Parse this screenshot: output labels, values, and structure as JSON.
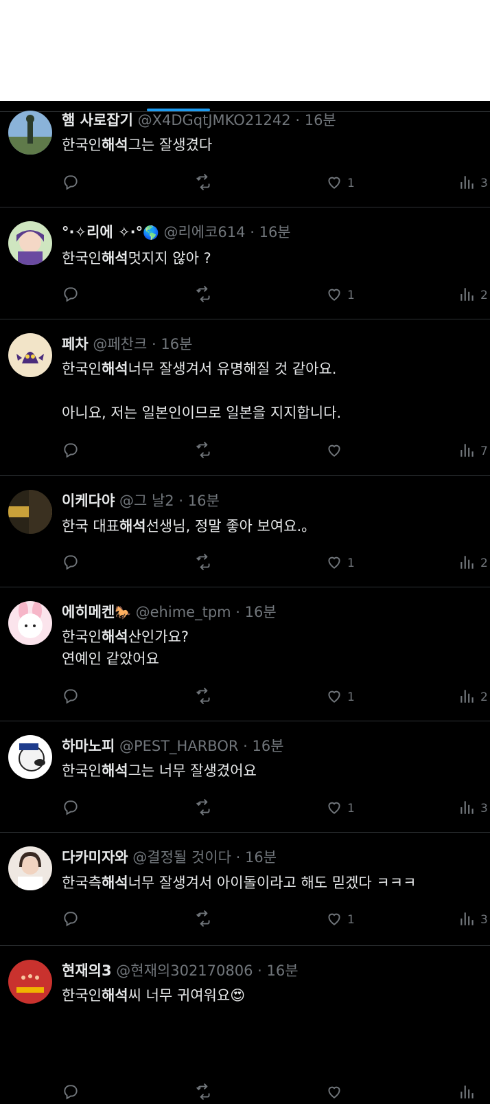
{
  "tweets": [
    {
      "name": "햄 사로잡기",
      "emoji": "",
      "handle": "@X4DGqtJMKO21242",
      "time": "16분",
      "body": [
        {
          "t": "한국인"
        },
        {
          "t": "해석",
          "b": true
        },
        {
          "t": "그는 잘생겼다"
        }
      ],
      "likes": "1",
      "views": "3"
    },
    {
      "name": "°·✧리에 ✧·°",
      "emoji": "🌎",
      "handle": "@리에코614",
      "time": "16분",
      "body": [
        {
          "t": "한국인"
        },
        {
          "t": "해석",
          "b": true
        },
        {
          "t": "멋지지 않아 ?"
        }
      ],
      "likes": "1",
      "views": "2"
    },
    {
      "name": "페차",
      "emoji": "",
      "handle": "@페찬크",
      "time": "16분",
      "body": [
        {
          "t": "한국인"
        },
        {
          "t": "해석",
          "b": true
        },
        {
          "t": "너무 잘생겨서 유명해질 것 같아요.\n\n아니요, 저는 일본인이므로 일본을 지지합니다."
        }
      ],
      "likes": "",
      "views": "7"
    },
    {
      "name": "이케다야",
      "emoji": "",
      "handle": "@그 날2",
      "time": "16분",
      "body": [
        {
          "t": "한국 대표"
        },
        {
          "t": "해석",
          "b": true
        },
        {
          "t": "선생님, 정말 좋아 보여요.。"
        }
      ],
      "likes": "1",
      "views": "2"
    },
    {
      "name": "에히메켄",
      "emoji": "🐎",
      "handle": "@ehime_tpm",
      "time": "16분",
      "body": [
        {
          "t": "한국인"
        },
        {
          "t": "해석",
          "b": true
        },
        {
          "t": "산인가요?\n연예인 같았어요"
        }
      ],
      "likes": "1",
      "views": "2"
    },
    {
      "name": "하마노피",
      "emoji": "",
      "handle": "@PEST_HARBOR",
      "time": "16분",
      "body": [
        {
          "t": "한국인"
        },
        {
          "t": "해석",
          "b": true
        },
        {
          "t": "그는 너무 잘생겼어요"
        }
      ],
      "likes": "1",
      "views": "3"
    },
    {
      "name": "다카미자와",
      "emoji": "",
      "handle": "@결정될 것이다",
      "time": "16분",
      "body": [
        {
          "t": "한국측"
        },
        {
          "t": "해석",
          "b": true
        },
        {
          "t": "너무 잘생겨서 아이돌이라고 해도 믿겠다 ㅋㅋㅋ"
        }
      ],
      "likes": "1",
      "views": "3"
    },
    {
      "name": "현재의3",
      "emoji": "",
      "handle": "@현재의302170806",
      "time": "16분",
      "body": [
        {
          "t": "한국인"
        },
        {
          "t": "해석",
          "b": true
        },
        {
          "t": "씨 너무 귀여워요"
        },
        {
          "t": "😍"
        }
      ],
      "likes": "",
      "views": ""
    }
  ],
  "separator": "·",
  "colors": {
    "accent": "#1d9bf0",
    "text": "#e7e9ea",
    "muted": "#71767b",
    "divider": "#2f3336"
  }
}
